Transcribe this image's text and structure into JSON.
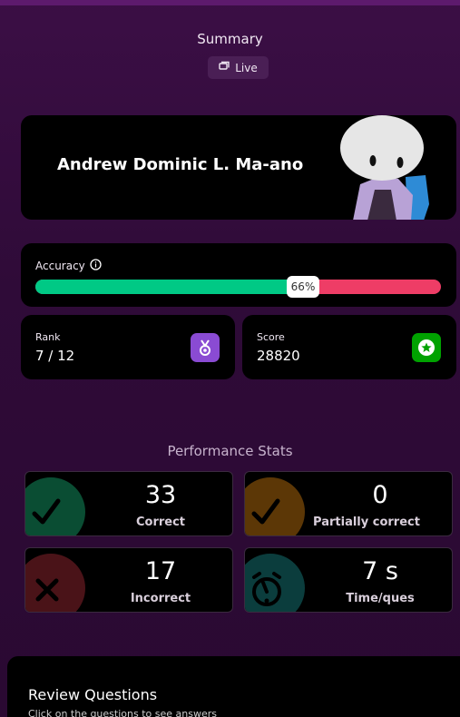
{
  "header": {
    "title": "Summary",
    "live_label": "Live"
  },
  "player": {
    "name": "Andrew Dominic L. Ma-ano"
  },
  "accuracy": {
    "label": "Accuracy",
    "percent_label": "66%",
    "fraction": 0.66
  },
  "rank": {
    "label": "Rank",
    "value": "7 / 12"
  },
  "score": {
    "label": "Score",
    "value": "28820"
  },
  "performance": {
    "title": "Performance Stats",
    "correct": {
      "value": "33",
      "label": "Correct"
    },
    "partial": {
      "value": "0",
      "label": "Partially correct"
    },
    "incorrect": {
      "value": "17",
      "label": "Incorrect"
    },
    "time": {
      "value": "7 s",
      "label": "Time/ques"
    }
  },
  "review": {
    "title": "Review Questions",
    "subtitle": "Click on the questions to see answers"
  },
  "colors": {
    "background": "#2c0a33",
    "correct": "#00c985",
    "incorrect": "#ee3d66",
    "rank_icon": "#8a4bd3",
    "score_icon": "#00a200"
  },
  "icons": {
    "live": "live-icon",
    "info": "info-icon",
    "rank": "medal-icon",
    "score": "star-icon",
    "correct": "check-icon",
    "partial": "check-icon",
    "incorrect": "cross-icon",
    "time": "stopwatch-icon"
  }
}
